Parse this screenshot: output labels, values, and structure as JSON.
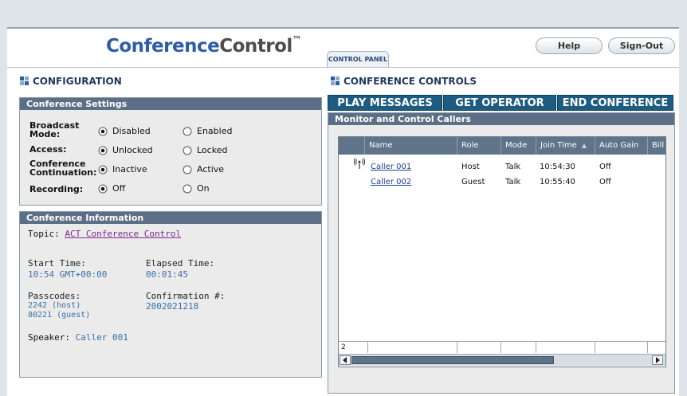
{
  "app": {
    "title_part1": "Conference",
    "title_part2": "Control",
    "title_tm": "™",
    "tab_label": "CONTROL PANEL",
    "help_label": "Help",
    "signout_label": "Sign-Out"
  },
  "configuration": {
    "title": "CONFIGURATION",
    "settings_header": "Conference Settings",
    "rows": [
      {
        "label": "Broadcast Mode:",
        "opt1": "Disabled",
        "opt2": "Enabled",
        "selected": 1
      },
      {
        "label": "Access:",
        "opt1": "Unlocked",
        "opt2": "Locked",
        "selected": 1
      },
      {
        "label": "Conference Continuation:",
        "opt1": "Inactive",
        "opt2": "Active",
        "selected": 1
      },
      {
        "label": "Recording:",
        "opt1": "Off",
        "opt2": "On",
        "selected": 1
      }
    ],
    "info_header": "Conference Information",
    "topic_label": "Topic:",
    "topic_value": "ACT Conference Control",
    "start_label": "Start Time:",
    "start_value": "10:54 GMT+00:00",
    "elapsed_label": "Elapsed Time:",
    "elapsed_value": "00:01:45",
    "passcodes_label": "Passcodes:",
    "passcode_host": "2242 (host)",
    "passcode_guest": "80221 (guest)",
    "confirmation_label": "Confirmation #:",
    "confirmation_value": "2002021218",
    "speaker_label": "Speaker:",
    "speaker_value": "Caller 001"
  },
  "controls": {
    "title": "CONFERENCE CONTROLS",
    "play_label": "PLAY MESSAGES",
    "operator_label": "GET OPERATOR",
    "end_label": "END CONFERENCE",
    "monitor_header": "Monitor and Control Callers",
    "columns": [
      "Name",
      "Role",
      "Mode",
      "Join Time",
      "Auto Gain",
      "Bill"
    ],
    "rows": [
      {
        "name": "Caller 001",
        "role": "Host",
        "mode": "Talk",
        "join": "10:54:30",
        "gain": "Off"
      },
      {
        "name": "Caller 002",
        "role": "Guest",
        "mode": "Talk",
        "join": "10:55:40",
        "gain": "Off"
      }
    ],
    "count": "2"
  },
  "colors": {
    "accent": "#2f5da0",
    "panel_header": "#5c6f86",
    "button": "#1d5b80"
  }
}
